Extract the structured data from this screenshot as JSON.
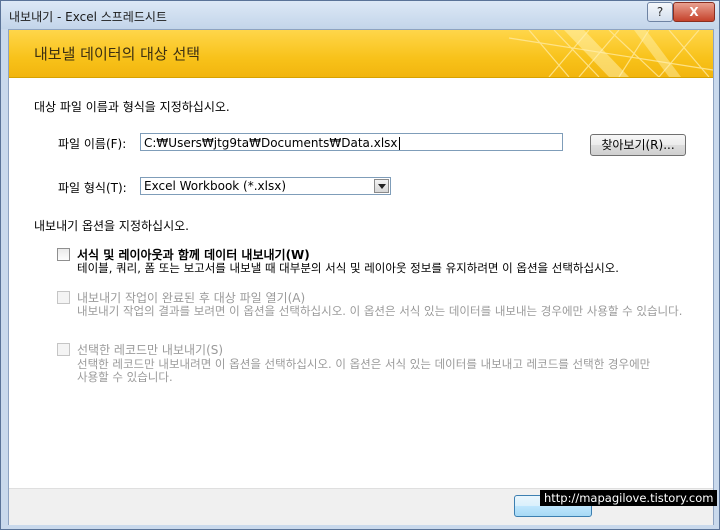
{
  "window": {
    "title": "내보내기 - Excel 스프레드시트",
    "help_label": "?",
    "close_label": "X"
  },
  "banner": {
    "title": "내보낼 데이터의 대상 선택"
  },
  "file_section": {
    "heading": "대상 파일 이름과 형식을 지정하십시오.",
    "file_name_label": "파일 이름(F):",
    "file_name_value": "C:₩Users₩jtg9ta₩Documents₩Data.xlsx",
    "browse_label": "찾아보기(R)...",
    "file_format_label": "파일 형식(T):",
    "file_format_value": "Excel Workbook (*.xlsx)"
  },
  "options_section": {
    "heading": "내보내기 옵션을 지정하십시오.",
    "options": [
      {
        "label": "서식 및 레이아웃과 함께 데이터 내보내기(W)",
        "description": "테이블, 쿼리, 폼 또는 보고서를 내보낼 때 대부분의 서식 및 레이아웃 정보를 유지하려면 이 옵션을 선택하십시오.",
        "checked": false,
        "enabled": true
      },
      {
        "label": "내보내기 작업이 완료된 후 대상 파일 열기(A)",
        "description": "내보내기 작업의 결과를 보려면 이 옵션을 선택하십시오. 이 옵션은 서식 있는 데이터를 내보내는 경우에만 사용할 수 있습니다.",
        "checked": false,
        "enabled": false
      },
      {
        "label": "선택한 레코드만 내보내기(S)",
        "description": "선택한 레코드만 내보내려면 이 옵션을 선택하십시오. 이 옵션은 서식 있는 데이터를 내보내고 레코드를 선택한 경우에만 사용할 수 있습니다.",
        "checked": false,
        "enabled": false
      }
    ]
  },
  "footer": {
    "watermark": "http://mapagilove.tistory.com"
  },
  "colors": {
    "banner_yellow": "#f8c21a",
    "frame_blue": "#c9d9ec",
    "close_red": "#c5422b"
  }
}
